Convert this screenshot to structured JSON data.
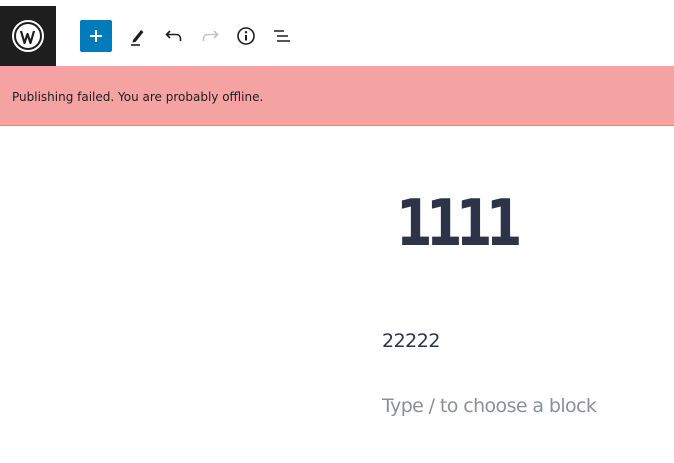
{
  "notice": {
    "message": "Publishing failed. You are probably offline."
  },
  "editor": {
    "heading": "1111",
    "paragraph": "22222",
    "placeholder": "Type / to choose a block"
  },
  "toolbar": {
    "icons": [
      "wordpress-icon",
      "plus-icon",
      "pencil-icon",
      "undo-icon",
      "redo-icon",
      "info-icon",
      "list-view-icon"
    ]
  },
  "colors": {
    "accent": "#007cba",
    "notice_bg": "#f4a2a2",
    "logo_bg": "#1e1e1e",
    "text": "#2e3448",
    "placeholder": "#8d8f96"
  }
}
